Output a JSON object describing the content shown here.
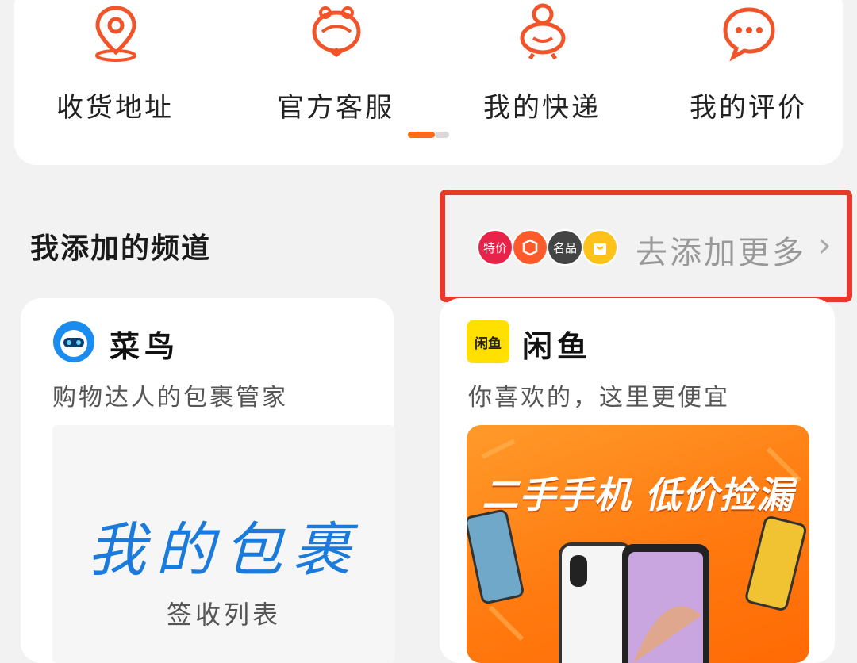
{
  "services": [
    {
      "label": "收货地址",
      "icon": "location-pin-icon"
    },
    {
      "label": "官方客服",
      "icon": "service-mascot-icon"
    },
    {
      "label": "我的快递",
      "icon": "courier-mascot-icon"
    },
    {
      "label": "我的评价",
      "icon": "chat-bubble-icon"
    }
  ],
  "section": {
    "title": "我添加的频道"
  },
  "add_more": {
    "text": "去添加更多",
    "badges": [
      {
        "label": "特价",
        "color": "#e8234a"
      },
      {
        "label": "",
        "color": "#ff5a2a"
      },
      {
        "label": "名品",
        "color": "#444444"
      },
      {
        "label": "",
        "color": "#ffc21a"
      }
    ]
  },
  "channels": [
    {
      "name": "菜鸟",
      "desc": "购物达人的包裹管家",
      "logo": "cainiao-logo-icon",
      "panel_title": "我的包裹",
      "panel_sub": "签收列表"
    },
    {
      "name": "闲鱼",
      "desc": "你喜欢的，这里更便宜",
      "logo": "xianyu-logo-icon",
      "logo_text": "闲鱼",
      "banner_text": "二手手机 低价捡漏"
    }
  ],
  "colors": {
    "accent": "#ff5a1f",
    "highlight_border": "#e8392c",
    "link_blue": "#1a7bdc"
  }
}
